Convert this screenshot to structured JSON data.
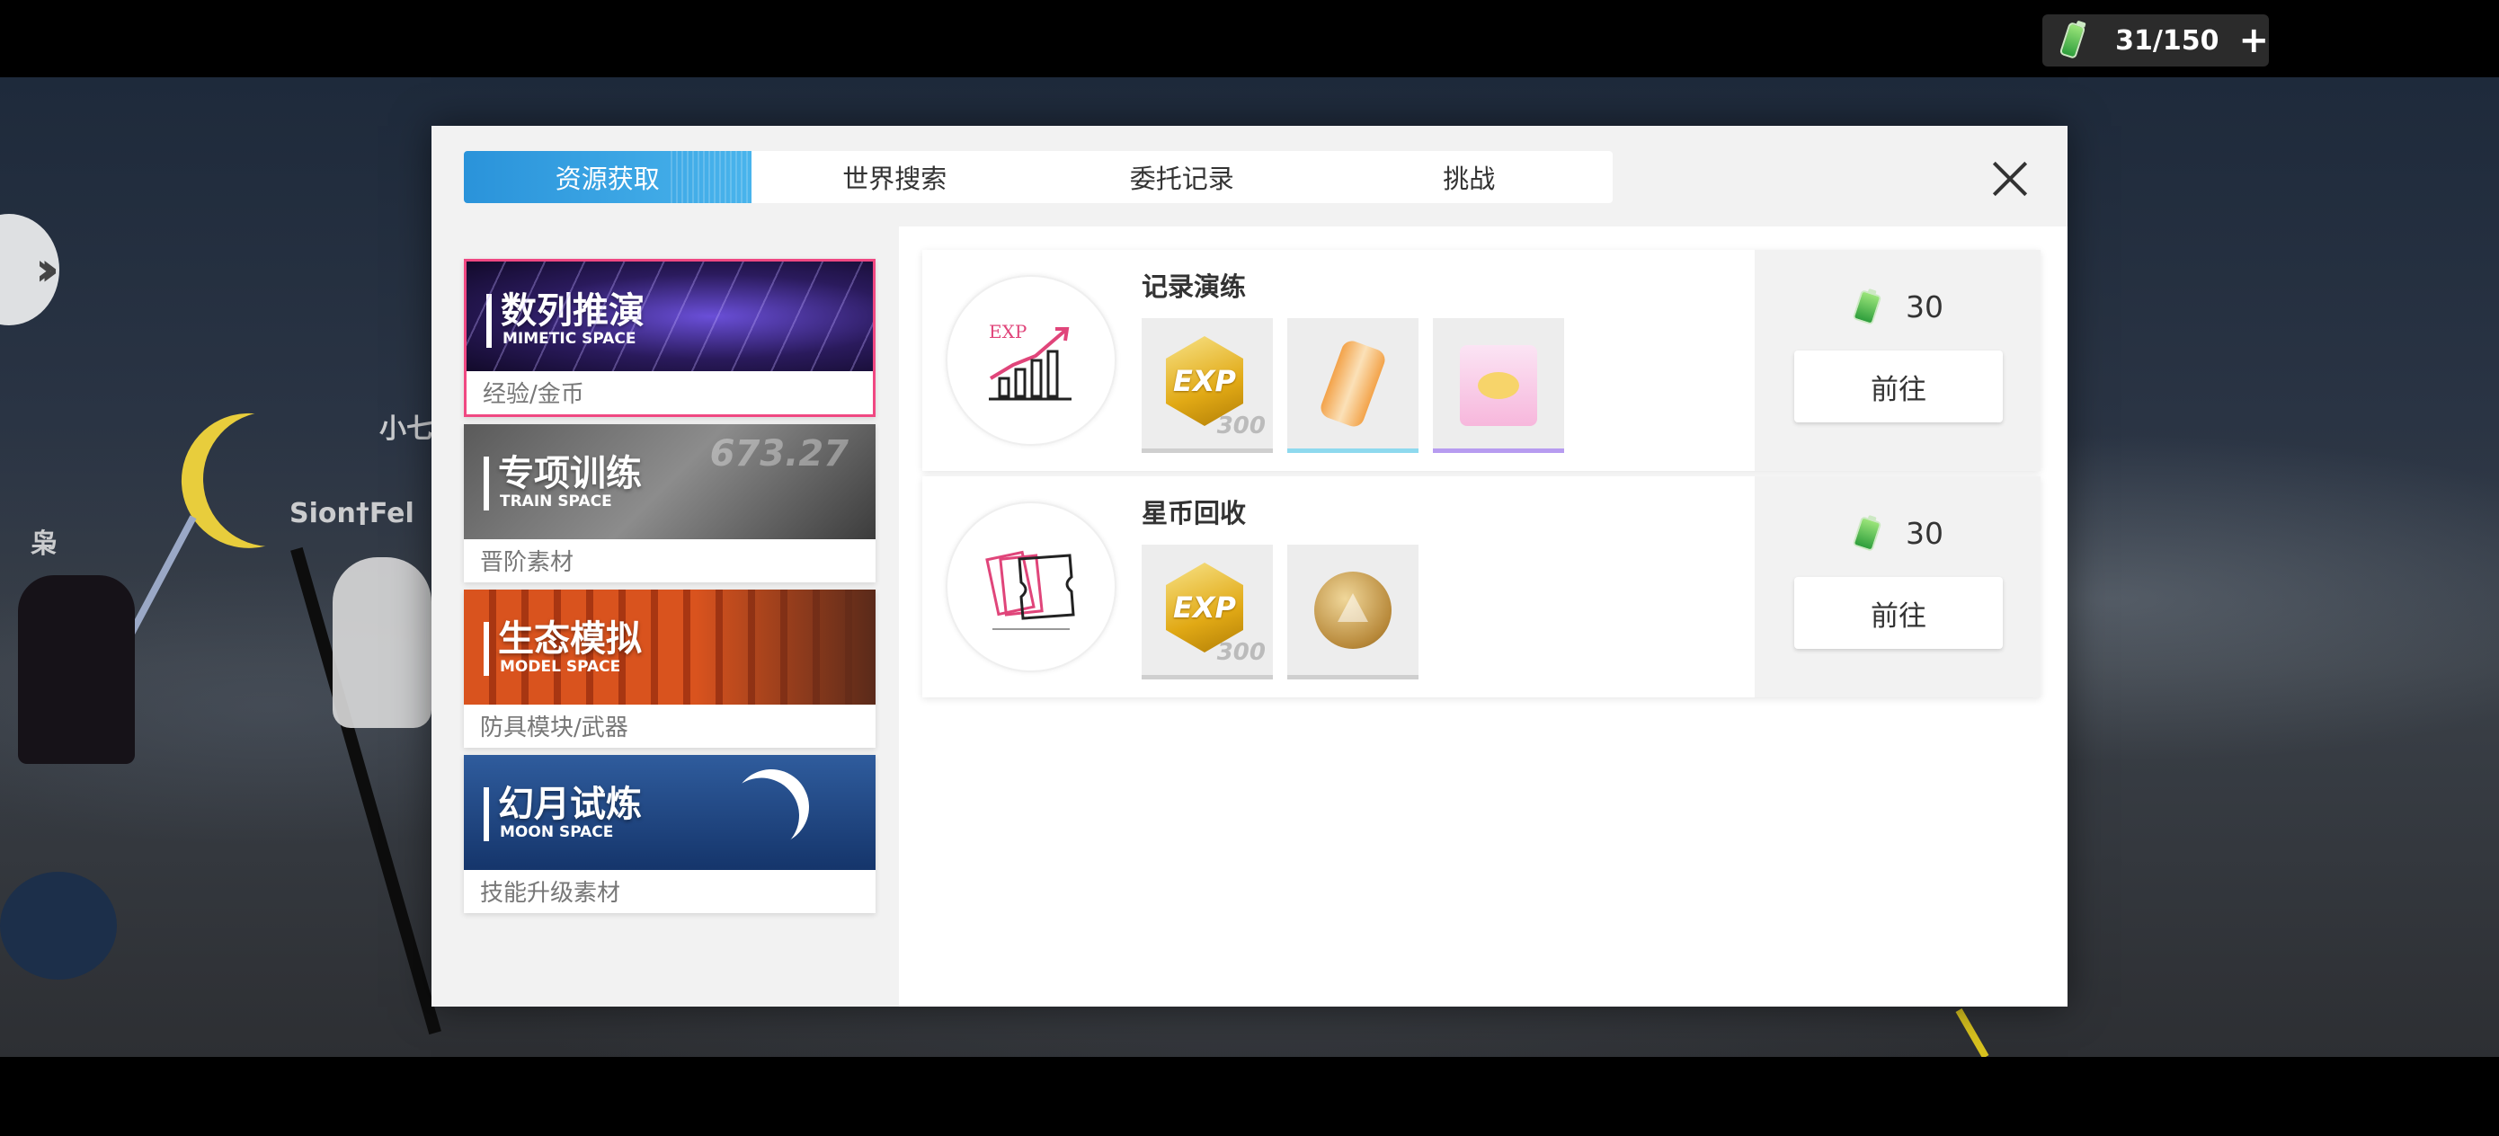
{
  "hud": {
    "stamina": "31/150",
    "stamina_add_icon": "plus-icon",
    "side_expand_icon": "double-chevron-right-icon",
    "player_names": [
      "小七",
      "Sion†Fel",
      "枭"
    ]
  },
  "dialog": {
    "tabs": [
      {
        "label": "资源获取",
        "active": true
      },
      {
        "label": "世界搜索",
        "active": false
      },
      {
        "label": "委托记录",
        "active": false
      },
      {
        "label": "挑战",
        "active": false
      }
    ],
    "close_icon": "close-icon",
    "categories": [
      {
        "title": "数列推演",
        "subtitle": "MIMETIC SPACE",
        "desc": "经验/金币",
        "active": true
      },
      {
        "title": "专项训练",
        "subtitle": "TRAIN SPACE",
        "desc": "晋阶素材",
        "active": false,
        "banner_number": "673.27"
      },
      {
        "title": "生态模拟",
        "subtitle": "MODEL SPACE",
        "desc": "防具模块/武器",
        "active": false
      },
      {
        "title": "幻月试炼",
        "subtitle": "MOON SPACE",
        "desc": "技能升级素材",
        "active": false
      }
    ],
    "entries": [
      {
        "title": "记录演练",
        "logo_text": "EXP",
        "rewards": [
          {
            "icon": "exp-badge",
            "label": "EXP",
            "count": "300",
            "rarity": "common"
          },
          {
            "icon": "energy-drink-can",
            "rarity": "blue"
          },
          {
            "icon": "snack-box",
            "rarity": "purple"
          }
        ],
        "cost": "30",
        "button_label": "前往"
      },
      {
        "title": "星币回收",
        "rewards": [
          {
            "icon": "exp-badge",
            "label": "EXP",
            "count": "300",
            "rarity": "common"
          },
          {
            "icon": "gold-coin",
            "rarity": "common"
          }
        ],
        "cost": "30",
        "button_label": "前往"
      }
    ]
  },
  "colors": {
    "tab_active": "#2a93da",
    "selected_border": "#f04882",
    "stamina_battery": "#2e9e3c"
  }
}
